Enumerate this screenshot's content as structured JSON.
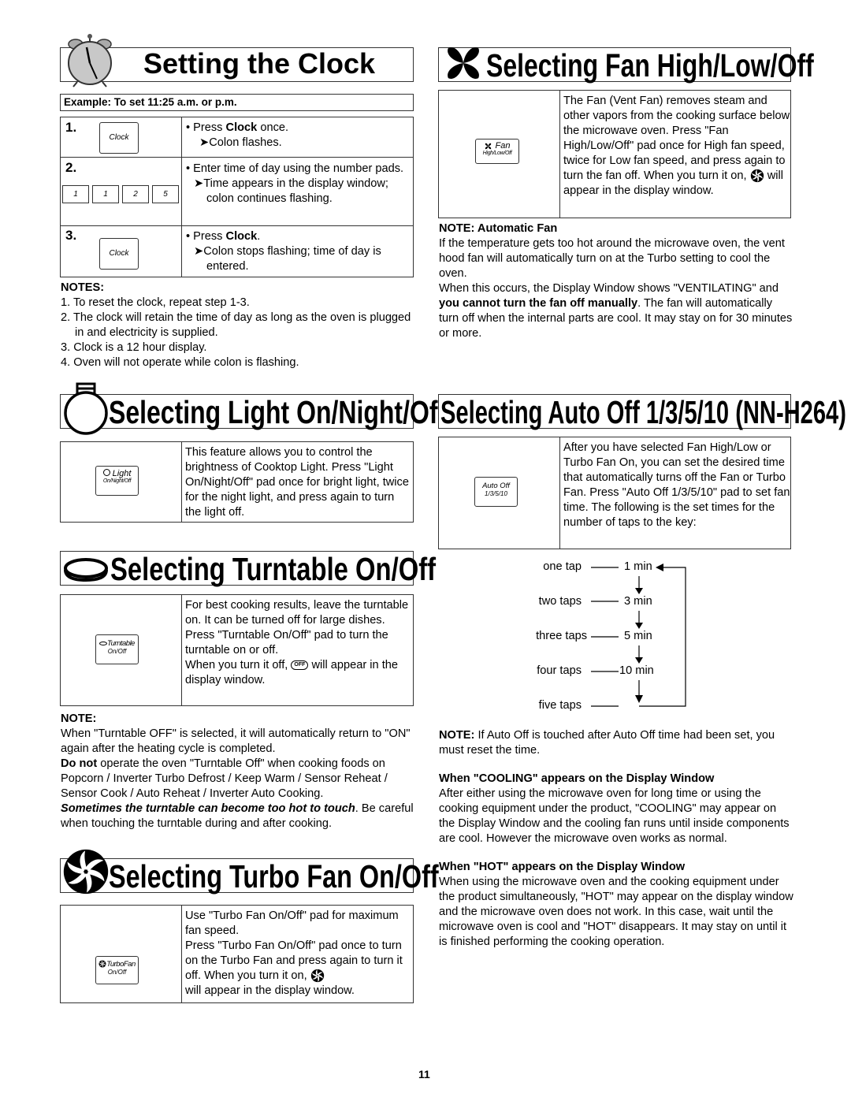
{
  "page_number": "11",
  "clock": {
    "title": "Setting the Clock",
    "example": "Example: To set 11:25 a.m. or p.m.",
    "steps": [
      {
        "num": "1.",
        "pads": [
          "Clock"
        ],
        "lines": [
          {
            "pre": "• Press ",
            "bold": "Clock",
            "post": " once."
          },
          {
            "arrow": "➤",
            "text": "Colon flashes."
          }
        ]
      },
      {
        "num": "2.",
        "pads": [
          "1",
          "1",
          "2",
          "5"
        ],
        "lines": [
          {
            "text": "• Enter time of day using the number pads."
          },
          {
            "arrow": "➤",
            "text": "Time appears in the display window; colon continues flashing."
          }
        ]
      },
      {
        "num": "3.",
        "pads": [
          "Clock"
        ],
        "lines": [
          {
            "pre": "• Press ",
            "bold": "Clock",
            "post": "."
          },
          {
            "arrow": "➤",
            "text": "Colon stops flashing; time of day is entered."
          }
        ]
      }
    ],
    "notes_heading": "NOTES:",
    "notes": [
      "1. To reset the clock, repeat step 1-3.",
      "2. The clock will retain the time of day as long as the oven is plugged in and electricity is supplied.",
      "3. Clock is a 12 hour display.",
      "4. Oven will not operate while colon is flashing."
    ]
  },
  "fan": {
    "title": "Selecting Fan High/Low/Off",
    "pad_line1": "Fan",
    "pad_line2": "High/Low/Off",
    "desc_a": "The Fan (Vent Fan) removes steam and other vapors from the cooking surface below the microwave oven. Press \"Fan High/Low/Off\" pad once for High fan speed, twice for Low fan speed, and press again to turn the fan off. When you turn it on,",
    "desc_b": "will appear in the display window.",
    "note_heading": "NOTE: Automatic Fan",
    "note_p1": "If the temperature gets too hot around the microwave oven, the vent hood fan will automatically turn on at the Turbo setting to cool the oven.",
    "note_p2_a": "When this occurs, the Display Window shows \"VENTILATING\" and ",
    "note_p2_bold": "you cannot turn the fan off manually",
    "note_p2_b": ". The fan will automatically turn off when the internal parts are cool. It may stay on for 30 minutes or more."
  },
  "light": {
    "title": "Selecting Light On/Night/Off",
    "pad_line1": "Light",
    "pad_line2": "On/Night/Off",
    "desc": "This feature allows you to control the brightness of Cooktop Light. Press \"Light On/Night/Off\" pad once for bright light, twice for the night light, and press again to turn the light off."
  },
  "auto_off": {
    "title": "Selecting Auto Off 1/3/5/10 (NN-H264)",
    "pad_line1": "Auto Off",
    "pad_line2": "1/3/5/10",
    "desc": "After you have selected Fan High/Low or Turbo Fan On, you can set the desired time that automatically turns off the Fan or Turbo Fan. Press \"Auto Off 1/3/5/10\" pad to set fan time. The following is the set times for the number of taps to the key:",
    "taps": [
      {
        "label": "one tap",
        "time": "1 min"
      },
      {
        "label": "two taps",
        "time": "3 min"
      },
      {
        "label": "three taps",
        "time": "5 min"
      },
      {
        "label": "four taps",
        "time": "10 min"
      },
      {
        "label": "five taps",
        "time": ""
      }
    ],
    "note_bold": "NOTE:",
    "note_text": " If Auto Off is touched after Auto Off time had been set, you must reset the time.",
    "cooling_heading": "When \"COOLING\" appears on the Display Window",
    "cooling_text": "After either using the microwave oven for long time or using the cooking equipment under the product, \"COOLING\" may appear on the Display Window and the cooling fan runs until inside components are cool. However the microwave oven works as normal.",
    "hot_heading": "When \"HOT\" appears on the Display Window",
    "hot_text": "When using the microwave oven and the cooking equipment under the product simultaneously, \"HOT\" may appear on the display window and the microwave oven does not work. In this case, wait until the microwave oven is cool and \"HOT\" disappears. It may stay on until it is finished performing the cooking operation."
  },
  "turntable": {
    "title": "Selecting Turntable On/Off",
    "pad_line1": "Turntable",
    "pad_line2": "On/Off",
    "desc_a": "For best cooking results, leave the turntable on. It can be turned off for large dishes.",
    "desc_b": "Press \"Turntable On/Off\" pad to turn the turntable on or off.",
    "desc_c1": "When you turn it off,",
    "desc_c2": "will appear in the display window.",
    "off_badge": "OFF",
    "note_heading": "NOTE:",
    "note_p1": "When \"Turntable OFF\" is selected, it will automatically return to \"ON\" again after the heating cycle is completed.",
    "note_p2_bold": "Do not",
    "note_p2": " operate the oven \"Turntable Off\" when cooking foods on Popcorn / Inverter Turbo Defrost / Keep Warm / Sensor Reheat / Sensor Cook / Auto Reheat / Inverter Auto Cooking.",
    "note_p3_bi": "Sometimes the turntable can become too hot to touch",
    "note_p3": ". Be careful when touching the turntable during and after cooking."
  },
  "turbo": {
    "title": "Selecting Turbo Fan On/Off",
    "pad_line1": "TurboFan",
    "pad_line2": "On/Off",
    "desc_a": "Use \"Turbo Fan On/Off\" pad for maximum fan speed.",
    "desc_b": "Press \"Turbo Fan On/Off\" pad once to turn on the Turbo Fan and press again to turn it off. When you turn it on,",
    "desc_c": "will appear in the display window."
  }
}
